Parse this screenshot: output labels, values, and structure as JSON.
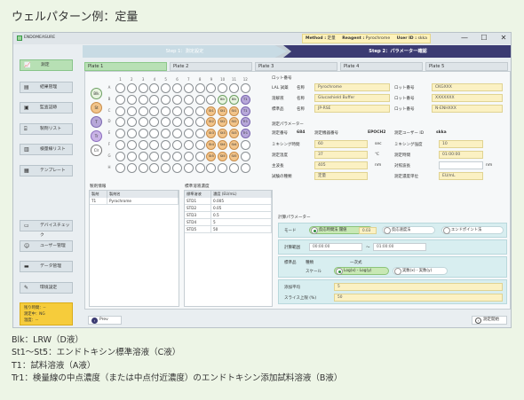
{
  "doc_title": "ウェルパターン例：定量",
  "app": {
    "name": "ENDOMEASURE"
  },
  "header": {
    "method_label": "Method :",
    "method_value": "定量",
    "reagent_label": "Reagent :",
    "reagent_value": "Pyrochrome",
    "user_label": "User ID :",
    "user_value": "skka"
  },
  "window_controls": {
    "minimize": "—",
    "maximize": "☐",
    "close": "✕"
  },
  "steps": {
    "step1": "Step 1：測定設定",
    "step2": "Step 2：パラメーター確認"
  },
  "sidebar": {
    "items": [
      {
        "label": "測定",
        "icon": "chart-icon"
      },
      {
        "label": "結果管理",
        "icon": "list-icon"
      },
      {
        "label": "監査証跡",
        "icon": "audit-icon"
      },
      {
        "label": "製剤リスト",
        "icon": "vial-icon"
      },
      {
        "label": "検量線リスト",
        "icon": "curve-icon"
      },
      {
        "label": "テンプレート",
        "icon": "template-icon"
      },
      {
        "label": "デバイスチェック",
        "icon": "device-icon"
      },
      {
        "label": "ユーザー管理",
        "icon": "user-icon"
      },
      {
        "label": "データ管理",
        "icon": "folder-icon"
      },
      {
        "label": "環境設定",
        "icon": "wrench-icon"
      }
    ],
    "status": {
      "line1": "残り時間：--",
      "line2": "測定中：NG",
      "line3": "温度：--"
    }
  },
  "tabs": [
    "Plate 1",
    "Plate 2",
    "Plate 3",
    "Plate 4",
    "Plate 5"
  ],
  "plate": {
    "columns": [
      "1",
      "2",
      "3",
      "4",
      "5",
      "6",
      "7",
      "8",
      "9",
      "10",
      "11",
      "12"
    ],
    "rows": [
      "A",
      "B",
      "C",
      "D",
      "E",
      "F",
      "G",
      "H"
    ],
    "wells": [
      {
        "row": 1,
        "col": 9,
        "label": "Blk",
        "kind": "blk"
      },
      {
        "row": 1,
        "col": 10,
        "label": "Blk",
        "kind": "blk"
      },
      {
        "row": 1,
        "col": 11,
        "label": "T1",
        "kind": "t"
      },
      {
        "row": 2,
        "col": 8,
        "label": "St1",
        "kind": "st"
      },
      {
        "row": 2,
        "col": 9,
        "label": "St1",
        "kind": "st"
      },
      {
        "row": 2,
        "col": 10,
        "label": "St1",
        "kind": "st"
      },
      {
        "row": 2,
        "col": 11,
        "label": "T1",
        "kind": "t"
      },
      {
        "row": 3,
        "col": 8,
        "label": "St2",
        "kind": "st"
      },
      {
        "row": 3,
        "col": 9,
        "label": "St2",
        "kind": "st"
      },
      {
        "row": 3,
        "col": 10,
        "label": "St2",
        "kind": "st"
      },
      {
        "row": 3,
        "col": 11,
        "label": "Tr1",
        "kind": "t"
      },
      {
        "row": 4,
        "col": 8,
        "label": "St3",
        "kind": "st"
      },
      {
        "row": 4,
        "col": 9,
        "label": "St3",
        "kind": "st"
      },
      {
        "row": 4,
        "col": 10,
        "label": "St3",
        "kind": "st"
      },
      {
        "row": 4,
        "col": 11,
        "label": "Tr1",
        "kind": "t"
      },
      {
        "row": 5,
        "col": 8,
        "label": "St4",
        "kind": "st"
      },
      {
        "row": 5,
        "col": 9,
        "label": "St4",
        "kind": "st"
      },
      {
        "row": 5,
        "col": 10,
        "label": "St4",
        "kind": "st"
      },
      {
        "row": 6,
        "col": 8,
        "label": "St5",
        "kind": "st"
      },
      {
        "row": 6,
        "col": 9,
        "label": "St5",
        "kind": "st"
      },
      {
        "row": 6,
        "col": 10,
        "label": "St5",
        "kind": "st"
      }
    ],
    "legend": [
      "Blk",
      "St",
      "T",
      "Tr",
      "Clr"
    ]
  },
  "lot": {
    "heading": "ロット番号",
    "rows": [
      {
        "label": "LAL 試薬",
        "name_label": "名称",
        "name": "Pyrochrome",
        "lot_label": "ロット番号",
        "lot": "CKGXXX"
      },
      {
        "label": "溶解液",
        "name_label": "名称",
        "name": "Glucashield Buffer",
        "lot_label": "ロット番号",
        "lot": "XXXXXXX"
      },
      {
        "label": "標準品",
        "name_label": "名称",
        "name": "JP-RSE",
        "lot_label": "ロット番号",
        "lot": "N-ENHXXX"
      }
    ]
  },
  "measure": {
    "heading": "測定パラメーター",
    "serial_label": "測定番号",
    "serial_value": "684",
    "device_label": "測定機器番号",
    "device_value": "EPOCH2",
    "uid_label": "測定ユーザー ID",
    "uid_value": "skka",
    "pre_label": "ミキシング時間",
    "pre_value": "60",
    "pre_unit": "sec",
    "mix_label": "ミキシング強度",
    "mix_value": "10",
    "temp_label": "測定温度",
    "temp_value": "37",
    "temp_unit": "℃",
    "time_label": "測定時間",
    "time_value": "01:00:00",
    "wave_label": "主波長",
    "wave_value": "405",
    "wave_unit": "nm",
    "ref_label": "対照波長",
    "ref_value": "",
    "ref_unit": "nm",
    "type_label": "試験の種類",
    "type_value": "定量",
    "unit_label": "測定濃度単位",
    "unit_value": "EU/mL"
  },
  "prep": {
    "heading": "製剤情報",
    "headers": [
      "製剤",
      "製剤名"
    ],
    "rows": [
      [
        "T1",
        "Pyrochrome"
      ]
    ]
  },
  "std": {
    "heading": "標準溶液濃度",
    "headers": [
      "標準溶液",
      "濃度 (EU/mL)"
    ],
    "rows": [
      [
        "STD1",
        "0.005"
      ],
      [
        "STD2",
        "0.05"
      ],
      [
        "STD3",
        "0.5"
      ],
      [
        "STD4",
        "5"
      ],
      [
        "STD5",
        "50"
      ]
    ]
  },
  "calc": {
    "heading": "計算パラメーター",
    "mode_label": "モード",
    "mode_opts": [
      "反応時間法 閾値",
      "反応速度法",
      "エンドポイント法"
    ],
    "threshold": "0.03",
    "range_label": "計算範囲",
    "range_from": "00:00:00",
    "range_sep": "〜",
    "range_to": "01:00:00",
    "std_label": "標準品",
    "curve_label": "種類",
    "curve_value": "一次式",
    "scale_label": "スケール",
    "scale_opts": [
      "Log(x) - Log(y)",
      "実数(x) - 実数(y)"
    ],
    "repeat_label": "添加平均",
    "repeat_value": "5",
    "ratio_label": "スライス上限 (%)",
    "ratio_value": "50"
  },
  "footer": {
    "prev": "Prev",
    "start": "測定開始",
    "prev_icon": "‹",
    "start_icon": "›"
  },
  "notes": [
    "Blk：LRW（D液）",
    "St1〜St5：エンドトキシン標準溶液（C液）",
    "T1：試料溶液（A液）",
    "Tr1：検量線の中点濃度（または中点付近濃度）のエンドトキシン添加試料溶液（B液）"
  ]
}
